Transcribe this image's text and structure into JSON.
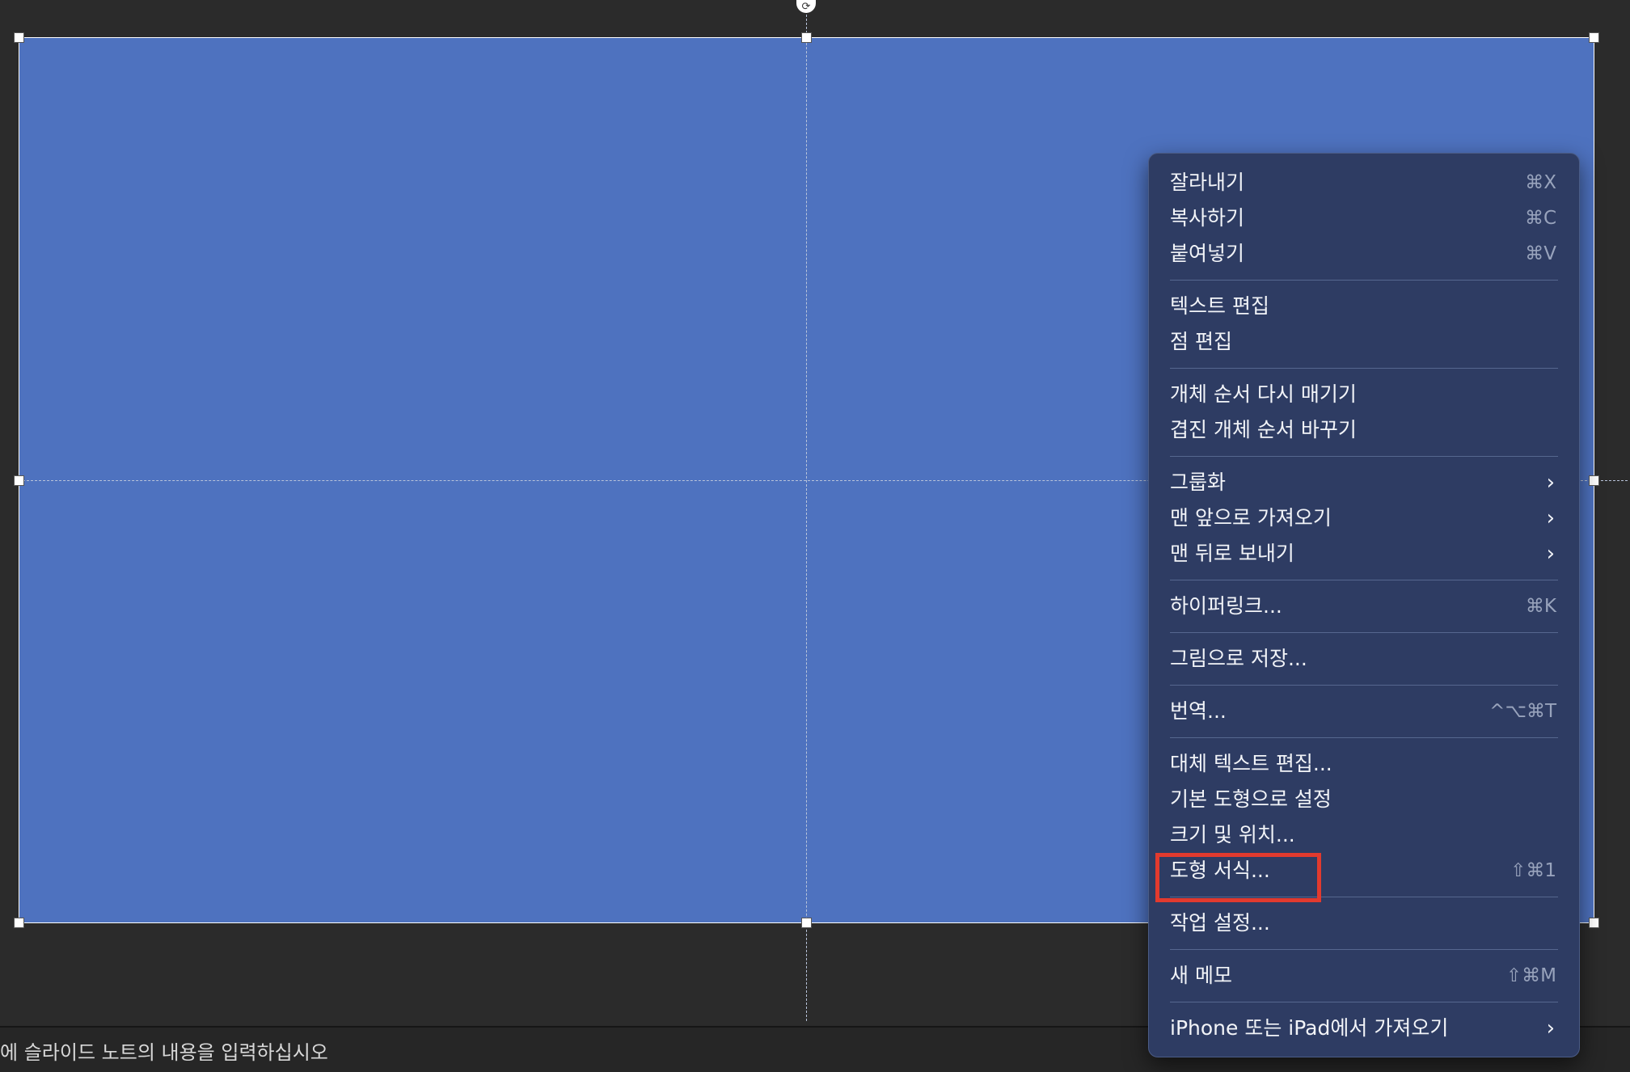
{
  "notes": {
    "placeholder_text": "에 슬라이드 노트의 내용을 입력하십시오"
  },
  "context_menu": {
    "groups": [
      [
        {
          "label": "잘라내기",
          "shortcut": "⌘X"
        },
        {
          "label": "복사하기",
          "shortcut": "⌘C"
        },
        {
          "label": "붙여넣기",
          "shortcut": "⌘V"
        }
      ],
      [
        {
          "label": "텍스트 편집"
        },
        {
          "label": "점 편집"
        }
      ],
      [
        {
          "label": "개체 순서 다시 매기기"
        },
        {
          "label": "겹진 개체 순서 바꾸기"
        }
      ],
      [
        {
          "label": "그룹화",
          "submenu": true
        },
        {
          "label": "맨 앞으로 가져오기",
          "submenu": true
        },
        {
          "label": "맨 뒤로 보내기",
          "submenu": true
        }
      ],
      [
        {
          "label": "하이퍼링크...",
          "shortcut": "⌘K"
        }
      ],
      [
        {
          "label": "그림으로 저장..."
        }
      ],
      [
        {
          "label": "번역...",
          "shortcut": "^⌥⌘T"
        }
      ],
      [
        {
          "label": "대체 텍스트 편집..."
        },
        {
          "label": "기본 도형으로 설정"
        },
        {
          "label": "크기 및 위치..."
        },
        {
          "label": "도형 서식...",
          "shortcut": "⇧⌘1",
          "highlighted": true
        }
      ],
      [
        {
          "label": "작업 설정..."
        }
      ],
      [
        {
          "label": "새 메모",
          "shortcut": "⇧⌘M"
        }
      ],
      [
        {
          "label": "iPhone 또는 iPad에서 가져오기",
          "submenu": true
        }
      ]
    ]
  },
  "colors": {
    "shape_fill": "#4e72bf",
    "menu_background": "#2e3c63",
    "highlight_border": "#e23a2e",
    "canvas_background": "#2b2b2b"
  },
  "icons": {
    "submenu": "chevron-right-icon",
    "rotate": "rotate-handle-icon"
  }
}
